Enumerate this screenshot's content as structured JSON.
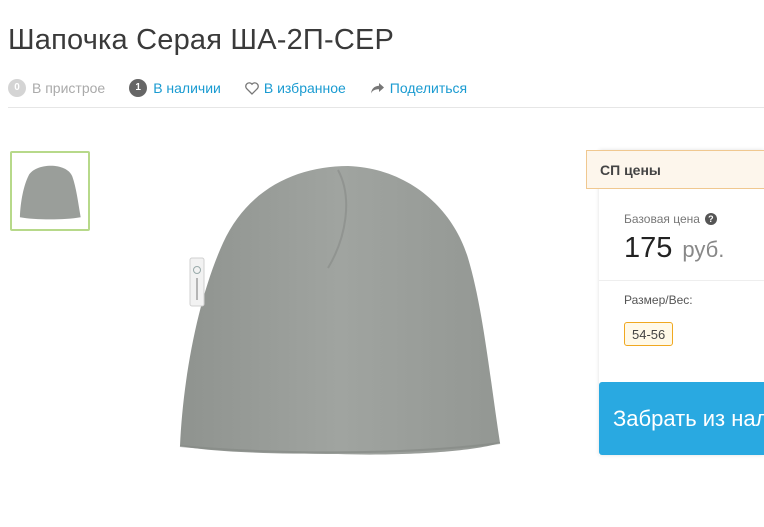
{
  "product": {
    "title": "Шапочка Серая ША-2П-СЕР"
  },
  "meta": {
    "attached_count": "0",
    "attached_label": "В пристрое",
    "stock_count": "1",
    "stock_label": "В наличии",
    "favorites_label": "В избранное",
    "share_label": "Поделиться"
  },
  "images": {
    "thumbnail_alt": "hat-thumbnail",
    "main_alt": "hat-main-image",
    "product_color": "#9a9e9a"
  },
  "price_panel": {
    "header": "СП цены",
    "base_price_label": "Базовая цена",
    "price_value": "175",
    "price_currency": "руб.",
    "size_label": "Размер/Вес:",
    "size_option": "54-56",
    "buy_button_label": "Забрать из наличия"
  },
  "colors": {
    "accent_link": "#1a9bd1",
    "buy_button": "#29a9e1",
    "size_chip_border": "#f0a820",
    "thumb_border": "#b7d98a"
  }
}
